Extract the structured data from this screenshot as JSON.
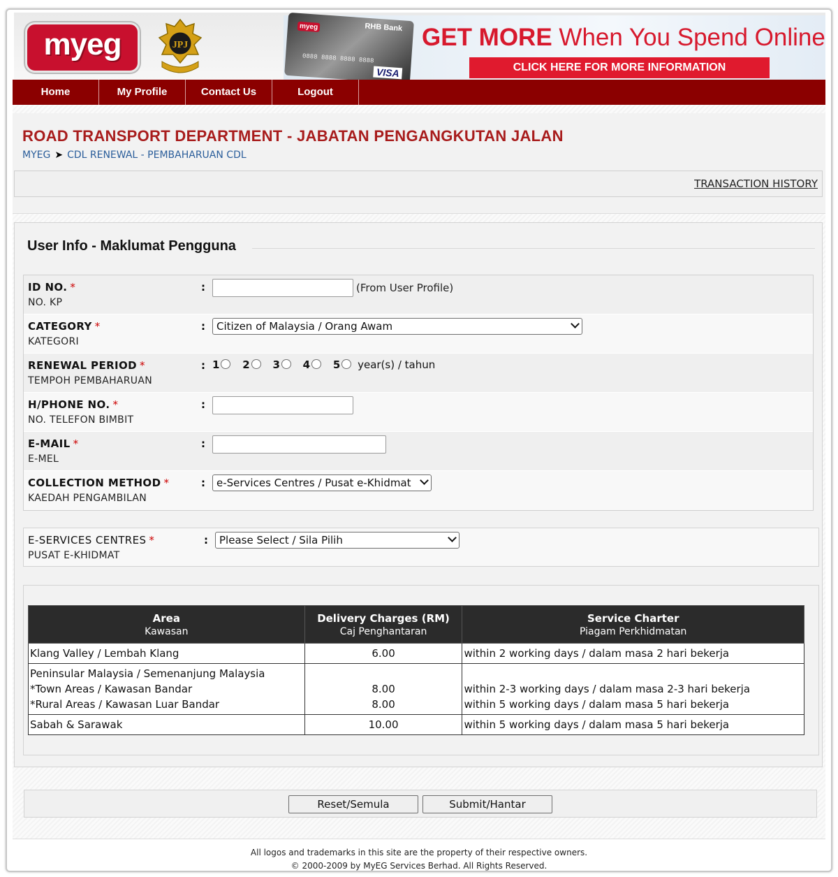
{
  "header": {
    "logo_text": "myeg",
    "banner_headline_bold": "GET MORE",
    "banner_headline_rest": " When You Spend Online",
    "banner_cta": "CLICK HERE FOR MORE INFORMATION",
    "card_bank": "RHB Bank",
    "card_brand": "myeg",
    "card_number": "0888 8888 8888 8888",
    "card_network": "VISA",
    "crest_initials": "JPJ"
  },
  "nav": {
    "items": [
      {
        "label": "Home"
      },
      {
        "label": "My Profile"
      },
      {
        "label": "Contact Us"
      },
      {
        "label": "Logout"
      }
    ]
  },
  "page": {
    "title": "ROAD TRANSPORT DEPARTMENT - JABATAN PENGANGKUTAN JALAN",
    "breadcrumb_root": "MYEG",
    "breadcrumb_sep": "➤",
    "breadcrumb_current": "CDL RENEWAL - PEMBAHARUAN CDL",
    "transaction_history": "TRANSACTION HISTORY"
  },
  "form": {
    "section_title": "User Info - Maklumat Pengguna",
    "required_mark": "*",
    "colon": ":",
    "id_no": {
      "label": "ID NO.",
      "sublabel": "NO. KP",
      "value": "",
      "hint": "(From User Profile)"
    },
    "category": {
      "label": "CATEGORY",
      "sublabel": "KATEGORI",
      "selected": "Citizen of Malaysia / Orang Awam"
    },
    "renewal_period": {
      "label": "RENEWAL PERIOD",
      "sublabel": "TEMPOH PEMBAHARUAN",
      "options": [
        "1",
        "2",
        "3",
        "4",
        "5"
      ],
      "suffix": "year(s) / tahun"
    },
    "phone": {
      "label": "H/PHONE NO.",
      "sublabel": "NO. TELEFON BIMBIT",
      "value": ""
    },
    "email": {
      "label": "E-MAIL",
      "sublabel": "E-MEL",
      "value": ""
    },
    "collection_method": {
      "label": "COLLECTION METHOD",
      "sublabel": "KAEDAH PENGAMBILAN",
      "selected": "e-Services Centres / Pusat e-Khidmat"
    },
    "eservices_centre": {
      "label": "E-SERVICES CENTRES",
      "sublabel": "PUSAT E-KHIDMAT",
      "selected": "Please Select / Sila Pilih"
    }
  },
  "charges_table": {
    "headers": [
      {
        "main": "Area",
        "sub": "Kawasan"
      },
      {
        "main": "Delivery Charges (RM)",
        "sub": "Caj Penghantaran"
      },
      {
        "main": "Service Charter",
        "sub": "Piagam Perkhidmatan"
      }
    ],
    "rows": [
      {
        "area": [
          "Klang Valley / Lembah Klang"
        ],
        "charge": [
          "6.00"
        ],
        "charter": [
          "within 2 working days / dalam masa 2 hari bekerja"
        ]
      },
      {
        "area": [
          "Peninsular Malaysia / Semenanjung Malaysia",
          "*Town Areas / Kawasan Bandar",
          "*Rural Areas / Kawasan Luar Bandar"
        ],
        "charge": [
          "",
          "8.00",
          "8.00"
        ],
        "charter": [
          "",
          "within 2-3 working days / dalam masa 2-3 hari bekerja",
          "within 5 working days / dalam masa 5 hari bekerja"
        ]
      },
      {
        "area": [
          "Sabah & Sarawak"
        ],
        "charge": [
          "10.00"
        ],
        "charter": [
          "within 5 working days / dalam masa 5 hari bekerja"
        ]
      }
    ]
  },
  "buttons": {
    "reset": "Reset/Semula",
    "submit": "Submit/Hantar"
  },
  "footer": {
    "line1": "All logos and trademarks in this site are the property of their respective owners.",
    "line2": "© 2000-2009 by MyEG Services Berhad. All Rights Reserved."
  },
  "colors": {
    "nav_bg": "#8b0000",
    "title_red": "#a81c1c",
    "link_blue": "#2a5d9a",
    "banner_red": "#e01a2e",
    "table_header": "#2b2b2b"
  }
}
